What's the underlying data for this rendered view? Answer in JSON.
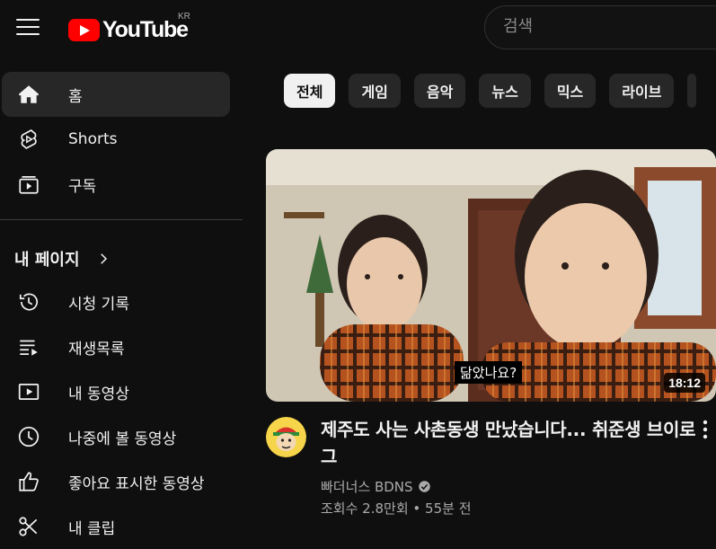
{
  "header": {
    "logo_text": "YouTube",
    "region": "KR",
    "search_placeholder": "검색"
  },
  "sidebar": {
    "main": [
      {
        "label": "홈",
        "icon": "home-icon",
        "active": true
      },
      {
        "label": "Shorts",
        "icon": "shorts-icon"
      },
      {
        "label": "구독",
        "icon": "subscriptions-icon"
      }
    ],
    "section_title": "내 페이지",
    "you": [
      {
        "label": "시청 기록",
        "icon": "history-icon"
      },
      {
        "label": "재생목록",
        "icon": "playlists-icon"
      },
      {
        "label": "내 동영상",
        "icon": "your-videos-icon"
      },
      {
        "label": "나중에 볼 동영상",
        "icon": "watch-later-icon"
      },
      {
        "label": "좋아요 표시한 동영상",
        "icon": "liked-videos-icon"
      },
      {
        "label": "내 클립",
        "icon": "clips-icon"
      }
    ]
  },
  "chips": [
    "전체",
    "게임",
    "음악",
    "뉴스",
    "믹스",
    "라이브"
  ],
  "video": {
    "caption": "닮았나요?",
    "duration": "18:12",
    "title": "제주도 사는 사촌동생 만났습니다... 취준생 브이로그",
    "channel": "빠더너스 BDNS",
    "views": "조회수 2.8만회",
    "age": "55분 전",
    "stats_separator": "•"
  },
  "colors": {
    "background": "#0f0f0f",
    "brand_red": "#ff0000",
    "chip_bg": "#272727",
    "chip_active_bg": "#f1f1f1",
    "secondary_text": "#aaaaaa"
  }
}
